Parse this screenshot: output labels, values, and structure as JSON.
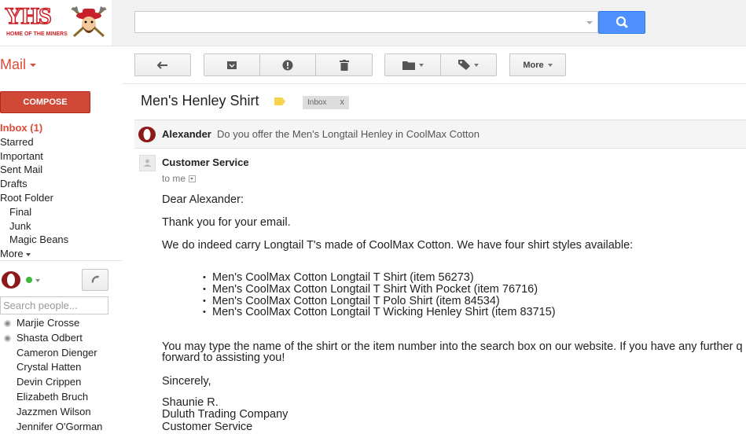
{
  "logo": {
    "text": "YHS",
    "tagline": "HOME OF THE MINERS"
  },
  "search": {
    "placeholder": ""
  },
  "toolbar": {
    "mail_label": "Mail",
    "more_label": "More",
    "icons": [
      "back-arrow-icon",
      "archive-icon",
      "report-spam-icon",
      "trash-icon",
      "folder-icon",
      "label-icon"
    ]
  },
  "compose_label": "COMPOSE",
  "nav": {
    "items": [
      {
        "label": "Inbox (1)"
      },
      {
        "label": "Starred"
      },
      {
        "label": "Important"
      },
      {
        "label": "Sent Mail"
      },
      {
        "label": "Drafts"
      },
      {
        "label": "Root Folder"
      },
      {
        "label": "Final"
      },
      {
        "label": "Junk"
      },
      {
        "label": "Magic Beans"
      },
      {
        "label": "More"
      }
    ]
  },
  "chat": {
    "search_placeholder": "Search people...",
    "contacts": [
      {
        "name": "Marjie Crosse"
      },
      {
        "name": "Shasta Odbert"
      },
      {
        "name": "Cameron Dienger"
      },
      {
        "name": "Crystal Hatten"
      },
      {
        "name": "Devin Crippen"
      },
      {
        "name": "Elizabeth Bruch"
      },
      {
        "name": "Jazzmen Wilson"
      },
      {
        "name": "Jennifer O'Gorman"
      }
    ]
  },
  "thread": {
    "subject": "Men's Henley Shirt",
    "label": "Inbox",
    "label_close": "x",
    "prev_sender": "Alexander",
    "prev_snippet": "Do you offer the Men's Longtail Henley in CoolMax Cotton",
    "sender": "Customer Service",
    "to": "to me",
    "body": {
      "greeting": "Dear Alexander:",
      "thanks": "Thank you for your email.",
      "intro": "We do indeed carry Longtail T's made of CoolMax Cotton. We have four shirt styles available:",
      "items": [
        "Men's CoolMax Cotton Longtail T Shirt (item 56273)",
        "Men's CoolMax Cotton Longtail T Shirt With Pocket (item 76716)",
        "Men's CoolMax Cotton Longtail T Polo Shirt (item 84534)",
        "Men's CoolMax Cotton Longtail T Wicking Henley Shirt (item 83715)"
      ],
      "para_line1": "You may type the name of the shirt or the item number into the search box on our website. If you have any further q",
      "para_line2": "forward to assisting you!",
      "closing": "Sincerely,",
      "sig_name": "Shaunie R.",
      "sig_company": "Duluth Trading Company",
      "sig_dept": "Customer Service"
    }
  },
  "colors": {
    "brand_red": "#dd4b39",
    "compose_red": "#d14836",
    "search_blue": "#4d90fe",
    "logo_red": "#cc1f25"
  }
}
